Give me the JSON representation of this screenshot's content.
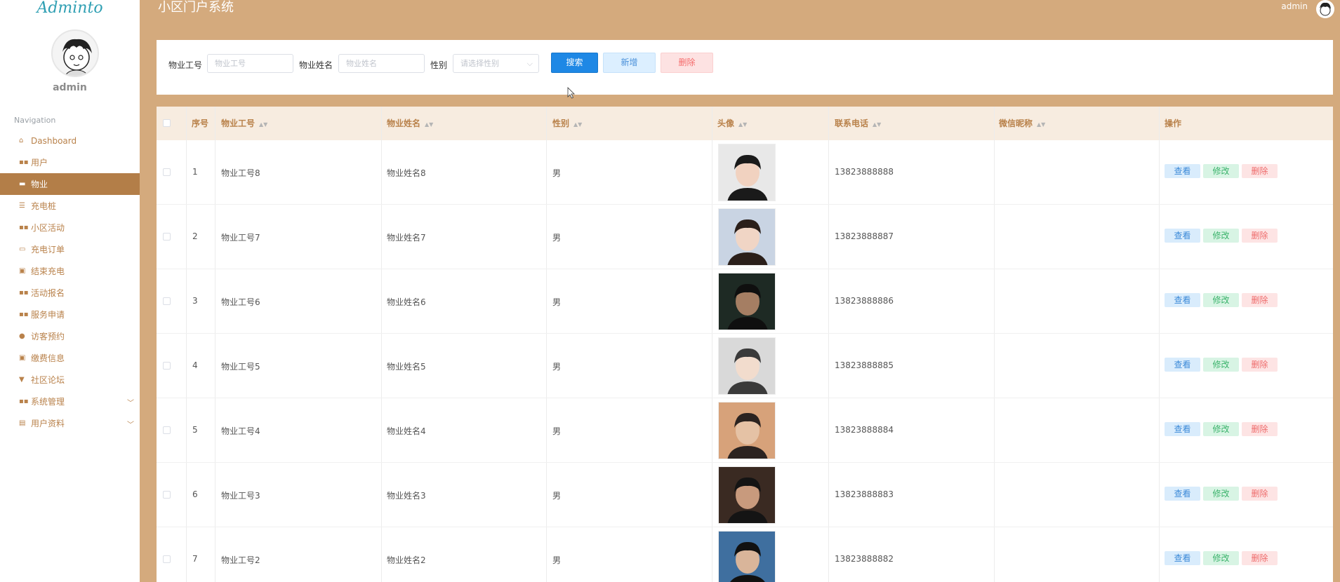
{
  "app": {
    "logo": "Adminto",
    "title": "小区门户系统",
    "user": "admin"
  },
  "sidebar": {
    "admin_name": "admin",
    "nav_title": "Navigation",
    "items": [
      {
        "label": "Dashboard",
        "icon": "home-icon"
      },
      {
        "label": "用户",
        "icon": "grid-icon"
      },
      {
        "label": "物业",
        "icon": "bookmark-icon",
        "active": true
      },
      {
        "label": "充电桩",
        "icon": "list-icon"
      },
      {
        "label": "小区活动",
        "icon": "grid-icon"
      },
      {
        "label": "充电订单",
        "icon": "briefcase-icon"
      },
      {
        "label": "结束充电",
        "icon": "clipboard-icon"
      },
      {
        "label": "活动报名",
        "icon": "grid-icon"
      },
      {
        "label": "服务申请",
        "icon": "grid-icon"
      },
      {
        "label": "访客预约",
        "icon": "pin-icon"
      },
      {
        "label": "缴费信息",
        "icon": "clipboard-icon"
      },
      {
        "label": "社区论坛",
        "icon": "signpost-icon"
      },
      {
        "label": "系统管理",
        "icon": "grid-icon",
        "expandable": true
      },
      {
        "label": "用户资料",
        "icon": "calendar-icon",
        "expandable": true
      }
    ]
  },
  "search": {
    "field1_label": "物业工号",
    "field1_placeholder": "物业工号",
    "field2_label": "物业姓名",
    "field2_placeholder": "物业姓名",
    "gender_label": "性别",
    "gender_placeholder": "请选择性别",
    "search_btn": "搜索",
    "add_btn": "新增",
    "delete_btn": "删除"
  },
  "table": {
    "headers": {
      "index": "序号",
      "staff_id": "物业工号",
      "name": "物业姓名",
      "gender": "性别",
      "avatar": "头像",
      "phone": "联系电话",
      "wechat": "微信昵称",
      "actions": "操作"
    },
    "action_labels": {
      "view": "查看",
      "edit": "修改",
      "delete": "删除"
    },
    "rows": [
      {
        "index": "1",
        "staff_id": "物业工号8",
        "name": "物业姓名8",
        "gender": "男",
        "phone": "13823888888",
        "wechat": ""
      },
      {
        "index": "2",
        "staff_id": "物业工号7",
        "name": "物业姓名7",
        "gender": "男",
        "phone": "13823888887",
        "wechat": ""
      },
      {
        "index": "3",
        "staff_id": "物业工号6",
        "name": "物业姓名6",
        "gender": "男",
        "phone": "13823888886",
        "wechat": ""
      },
      {
        "index": "4",
        "staff_id": "物业工号5",
        "name": "物业姓名5",
        "gender": "男",
        "phone": "13823888885",
        "wechat": ""
      },
      {
        "index": "5",
        "staff_id": "物业工号4",
        "name": "物业姓名4",
        "gender": "男",
        "phone": "13823888884",
        "wechat": ""
      },
      {
        "index": "6",
        "staff_id": "物业工号3",
        "name": "物业姓名3",
        "gender": "男",
        "phone": "13823888883",
        "wechat": ""
      },
      {
        "index": "7",
        "staff_id": "物业工号2",
        "name": "物业姓名2",
        "gender": "男",
        "phone": "13823888882",
        "wechat": ""
      }
    ]
  },
  "colors": {
    "accent": "#d4aa7d",
    "sidebar_active": "#b37e48",
    "primary": "#1e88e5"
  }
}
